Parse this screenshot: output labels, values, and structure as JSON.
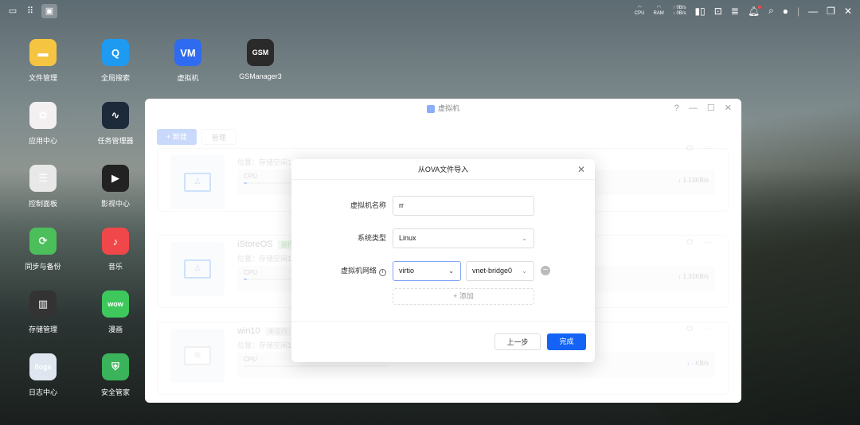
{
  "topbar": {
    "cpu": "CPU",
    "ram": "RAM",
    "up": "↑ 0B/s",
    "down": "↓ 0B/s"
  },
  "desktop": [
    {
      "label": "文件管理",
      "color": "#f5c542",
      "glyph": "▬"
    },
    {
      "label": "应用中心",
      "color": "#f4f0f2",
      "glyph": "✿"
    },
    {
      "label": "控制面板",
      "color": "#e8e8e8",
      "glyph": "☰"
    },
    {
      "label": "同步与备份",
      "color": "#4cbf5a",
      "glyph": "⟳"
    },
    {
      "label": "存储管理",
      "color": "#333",
      "glyph": "▥"
    },
    {
      "label": "日志中心",
      "color": "#dfe6f0",
      "glyph": "/logs"
    },
    {
      "label": "全局搜索",
      "color": "#1e9bf0",
      "glyph": "Q"
    },
    {
      "label": "任务管理器",
      "color": "#1d2a3a",
      "glyph": "∿"
    },
    {
      "label": "影视中心",
      "color": "#222",
      "glyph": "▶"
    },
    {
      "label": "音乐",
      "color": "#f0484a",
      "glyph": "♪"
    },
    {
      "label": "漫画",
      "color": "#3ec85c",
      "glyph": "wow"
    },
    {
      "label": "安全管家",
      "color": "#3ab35a",
      "glyph": "⛨"
    },
    {
      "label": "虚拟机",
      "color": "#2f6bf0",
      "glyph": "VM"
    },
    {
      "label": "GSManager3",
      "color": "#2a2a2a",
      "glyph": "GSM"
    }
  ],
  "window": {
    "title": "虚拟机",
    "help": "?",
    "new_btn": "+ 新建",
    "manage_btn": "管理"
  },
  "vms": [
    {
      "name": "",
      "status": "",
      "location": "位置：存储空间1",
      "cpu": "CPU",
      "rate": "1.13KB/s",
      "icon": "linux"
    },
    {
      "name": "iStoreOS",
      "status": "运行",
      "location": "位置：存储空间1",
      "cpu": "CPU",
      "rate": "1.31KB/s",
      "icon": "linux"
    },
    {
      "name": "win10",
      "status": "未运行",
      "location": "位置：存储空间1",
      "cpu": "CPU",
      "rate": "- KB/s",
      "icon": "windows"
    }
  ],
  "modal": {
    "title": "从OVA文件导入",
    "name_label": "虚拟机名称",
    "name_value": "rr",
    "os_label": "系统类型",
    "os_value": "Linux",
    "net_label": "虚拟机网络",
    "net_model": "virtio",
    "net_bridge": "vnet-bridge0",
    "add": "+ 添加",
    "prev": "上一步",
    "done": "完成"
  }
}
